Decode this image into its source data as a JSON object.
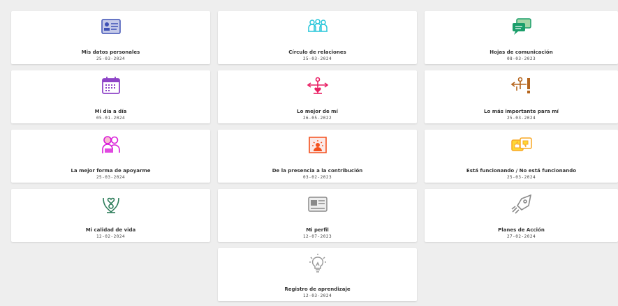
{
  "cards": [
    {
      "title": "Mis datos personales",
      "date": "25-03-2024",
      "icon": "id-card-icon",
      "color": "#3f51b5"
    },
    {
      "title": "Círculo de relaciones",
      "date": "25-03-2024",
      "icon": "people-circle-icon",
      "color": "#26c6da"
    },
    {
      "title": "Hojas de comunicación",
      "date": "08-03-2023",
      "icon": "chat-bubbles-icon",
      "color": "#1b9e6a"
    },
    {
      "title": "Mi día a día",
      "date": "05-01-2024",
      "icon": "calendar-icon",
      "color": "#8e44c7"
    },
    {
      "title": "Lo mejor de mí",
      "date": "26-05-2022",
      "icon": "heart-scale-icon",
      "color": "#e91e63"
    },
    {
      "title": "Lo más importante para mí",
      "date": "25-03-2024",
      "icon": "priority-icon",
      "color": "#b5651d"
    },
    {
      "title": "La mejor forma de apoyarme",
      "date": "25-03-2024",
      "icon": "support-people-icon",
      "color": "#d81bd8"
    },
    {
      "title": "De la presencia a la contribución",
      "date": "03-02-2023",
      "icon": "contribution-icon",
      "color": "#f4511e"
    },
    {
      "title": "Está funcionando / No está funcionando",
      "date": "25-03-2024",
      "icon": "thumbs-icon",
      "color": "#f9a825"
    },
    {
      "title": "Mi calidad de vida",
      "date": "12-02-2024",
      "icon": "wellbeing-icon",
      "color": "#2e7d5b"
    },
    {
      "title": "Mi perfil",
      "date": "12-07-2023",
      "icon": "profile-card-icon",
      "color": "#8a8a8a"
    },
    {
      "title": "Planes de Acción",
      "date": "27-02-2024",
      "icon": "rocket-icon",
      "color": "#8a8a8a"
    },
    {
      "title": "Registro de aprendizaje",
      "date": "12-03-2024",
      "icon": "lightbulb-icon",
      "color": "#9a9a9a"
    }
  ]
}
